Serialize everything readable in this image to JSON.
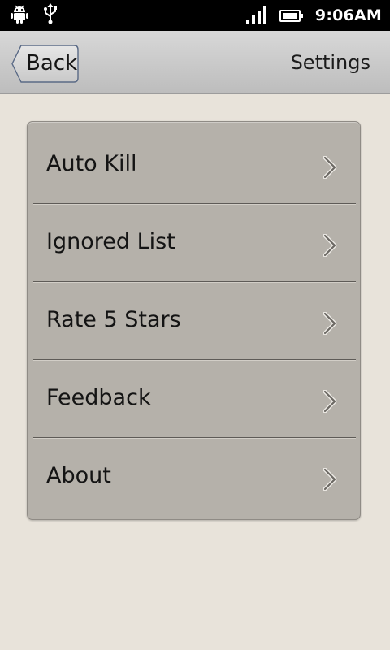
{
  "status_bar": {
    "time": "9:06AM",
    "icons": [
      "android-icon",
      "usb-icon",
      "signal-icon",
      "battery-icon"
    ]
  },
  "title_bar": {
    "back_label": "Back",
    "title": "Settings"
  },
  "menu": {
    "items": [
      {
        "label": "Auto Kill",
        "icon": "chevron-right-icon"
      },
      {
        "label": "Ignored List",
        "icon": "chevron-right-icon"
      },
      {
        "label": "Rate 5 Stars",
        "icon": "chevron-right-icon"
      },
      {
        "label": "Feedback",
        "icon": "chevron-right-icon"
      },
      {
        "label": "About",
        "icon": "chevron-right-icon"
      }
    ]
  },
  "colors": {
    "status_bar_bg": "#000000",
    "title_bar_bg": "#c8c8c8",
    "panel_bg": "#b5b1aa",
    "page_bg": "#e8e3da",
    "text": "#141414"
  }
}
